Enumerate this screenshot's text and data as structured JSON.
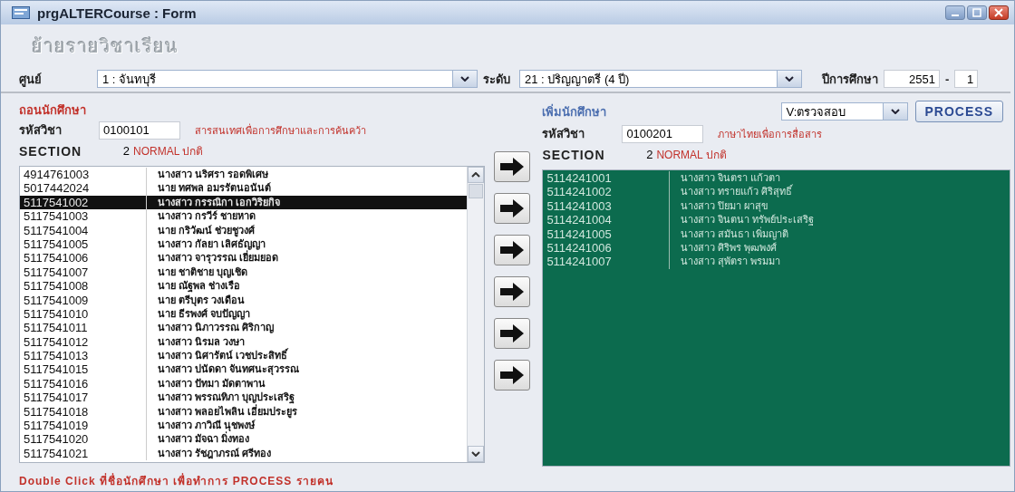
{
  "window": {
    "title": "prgALTERCourse : Form"
  },
  "form_title": "ย้ายรายวิชาเรียน",
  "filters": {
    "center_label": "ศูนย์",
    "center_value": "1 : จันทบุรี",
    "level_label": "ระดับ",
    "level_value": "21 : ปริญญาตรี (4 ปี)",
    "year_label": "ปีการศึกษา",
    "year_value": "2551",
    "separator": "-",
    "term_value": "1"
  },
  "withdraw": {
    "heading": "ถอนนักศึกษา",
    "course_label": "รหัสวิชา",
    "course_code": "0100101",
    "course_name": "สารสนเทศเพื่อการศึกษาและการค้นคว้า",
    "section_label": "SECTION",
    "section_value": "2",
    "section_type": "NORMAL ปกติ",
    "students": [
      {
        "id": "4914761003",
        "name": "นางสาว นริศรา รอดพิเศษ",
        "selected": false
      },
      {
        "id": "5017442024",
        "name": "นาย ทศพล อมรรัตนอนันต์",
        "selected": false
      },
      {
        "id": "5117541002",
        "name": "นางสาว กรรณิกา เอกวิริยกิจ",
        "selected": true
      },
      {
        "id": "5117541003",
        "name": "นางสาว กรวีร์ ชายหาด",
        "selected": false
      },
      {
        "id": "5117541004",
        "name": "นาย กริวัฒน์ ช่วยชูวงศ์",
        "selected": false
      },
      {
        "id": "5117541005",
        "name": "นางสาว กัลยา เลิศธัญญา",
        "selected": false
      },
      {
        "id": "5117541006",
        "name": "นางสาว จารุวรรณ เยี่ยมยอด",
        "selected": false
      },
      {
        "id": "5117541007",
        "name": "นาย ชาติชาย บุญเชิด",
        "selected": false
      },
      {
        "id": "5117541008",
        "name": "นาย ณัฐพล ช่างเรือ",
        "selected": false
      },
      {
        "id": "5117541009",
        "name": "นาย ตรีบุตร วงเดือน",
        "selected": false
      },
      {
        "id": "5117541010",
        "name": "นาย ธีรพงศ์ จบปัญญา",
        "selected": false
      },
      {
        "id": "5117541011",
        "name": "นางสาว นิภาวรรณ ศิริกาญ",
        "selected": false
      },
      {
        "id": "5117541012",
        "name": "นางสาว นิรมล วงษา",
        "selected": false
      },
      {
        "id": "5117541013",
        "name": "นางสาว นิศารัตน์ เวชประสิทธิ์",
        "selected": false
      },
      {
        "id": "5117541015",
        "name": "นางสาว ปนัดดา จันทศนะสุวรรณ",
        "selected": false
      },
      {
        "id": "5117541016",
        "name": "นางสาว ปัทมา มัดตาพาน",
        "selected": false
      },
      {
        "id": "5117541017",
        "name": "นางสาว พรรณทิภา บุญประเสริฐ",
        "selected": false
      },
      {
        "id": "5117541018",
        "name": "นางสาว พลอยไพลิน เอี่ยมประยูร",
        "selected": false
      },
      {
        "id": "5117541019",
        "name": "นางสาว ภาวิณี นุชพงษ์",
        "selected": false
      },
      {
        "id": "5117541020",
        "name": "นางสาว มัจฉา มิ่งทอง",
        "selected": false
      },
      {
        "id": "5117541021",
        "name": "นางสาว รัชฎาภรณ์ ศรีทอง",
        "selected": false
      }
    ]
  },
  "move_buttons": [
    {
      "kind": "arrow"
    },
    {
      "kind": "arrow"
    },
    {
      "kind": "arrow"
    },
    {
      "kind": "arrow"
    },
    {
      "kind": "arrow"
    },
    {
      "kind": "arrow"
    }
  ],
  "add": {
    "heading": "เพิ่มนักศึกษา",
    "mode_value": "V:ตรวจสอบ",
    "process_button": "PROCESS",
    "course_label": "รหัสวิชา",
    "course_code": "0100201",
    "course_name": "ภาษาไทยเพื่อการสื่อสาร",
    "section_label": "SECTION",
    "section_value": "2",
    "section_type": "NORMAL ปกติ",
    "students": [
      {
        "id": "5114241001",
        "name": "นางสาว จินตรา แก้วตา"
      },
      {
        "id": "5114241002",
        "name": "นางสาว ทรายแก้ว ศิริสุทธิ์"
      },
      {
        "id": "5114241003",
        "name": "นางสาว ปิยมา ผาสุข"
      },
      {
        "id": "5114241004",
        "name": "นางสาว จินตนา ทรัพย์ประเสริฐ"
      },
      {
        "id": "5114241005",
        "name": "นางสาว สมันธา เพิ่มญาติ"
      },
      {
        "id": "5114241006",
        "name": "นางสาว ศิริพร พุฒพงศ์"
      },
      {
        "id": "5114241007",
        "name": "นางสาว สุพัตรา พรมมา"
      }
    ]
  },
  "footer_hint": "Double Click ที่ชื่อนักศึกษา เพื่อทำการ PROCESS รายคน"
}
